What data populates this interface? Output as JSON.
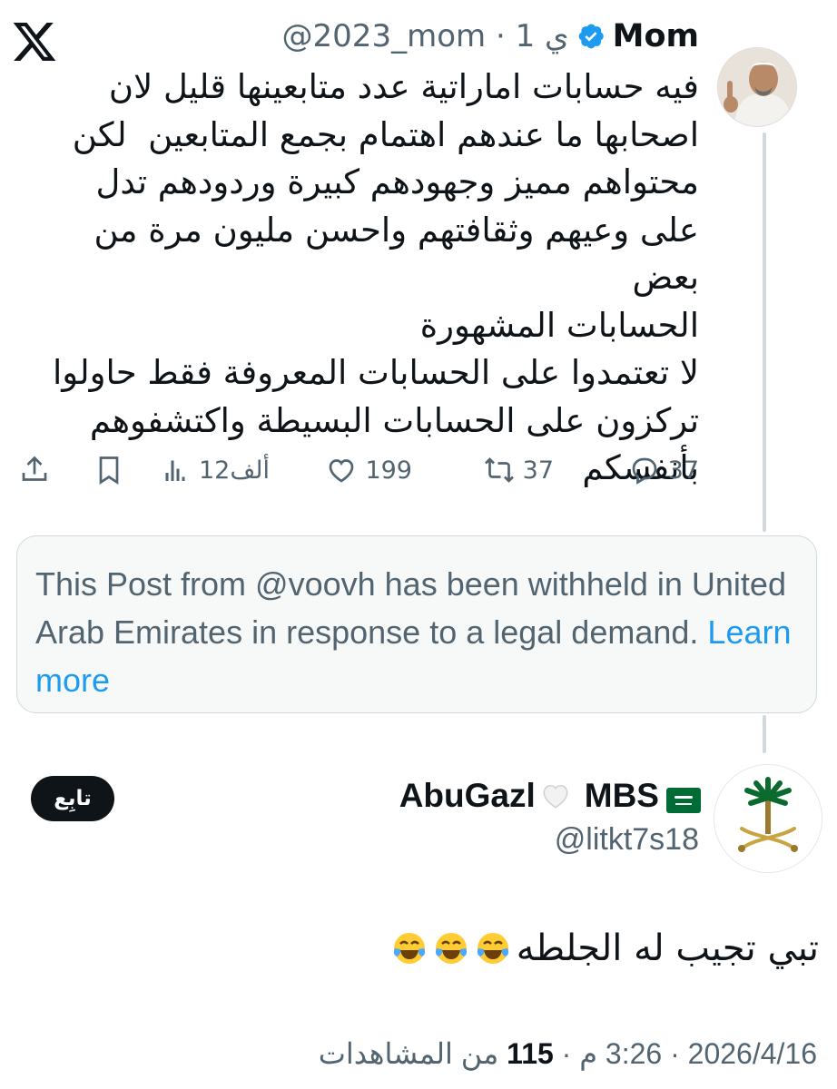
{
  "header": {
    "x_logo": "x-logo-icon",
    "author_name": "Mom",
    "author_handle": "@2023_mom",
    "time_text": "1 ي",
    "separator": "·"
  },
  "tweet": {
    "text": "فيه حسابات اماراتية عدد متابعينها قليل لان\nاصحابها ما عندهم اهتمام بجمع المتابعين  لكن\nمحتواهم مميز وجهودهم كبيرة وردودهم تدل\nعلى وعيهم وثقافتهم واحسن مليون مرة من بعض\nالحسابات المشهورة\nلا تعتمدوا على الحسابات المعروفة فقط حاولوا\nتركزون على الحسابات البسيطة واكتشفوهم\nبأنفسكم"
  },
  "actions": {
    "replies": "37",
    "reposts": "37",
    "likes": "199",
    "views": "12ألف",
    "icons": [
      "reply-icon",
      "repost-icon",
      "like-icon",
      "views-icon",
      "bookmark-icon",
      "share-icon"
    ]
  },
  "withheld": {
    "message": "This Post from @voovh has been withheld in United Arab Emirates in response to a legal demand.",
    "link": "Learn more"
  },
  "reply_author": {
    "name_a": "AbuGazl",
    "name_b": "MBS",
    "handle": "@litkt7s18",
    "follow_label": "تابِع"
  },
  "reply": {
    "text": "تبي تجيب له الجلطه",
    "emoji_count": 3
  },
  "footer": {
    "date": "2026/4/16",
    "time": "3:26 م",
    "views_count": "115",
    "views_label": "من المشاهدات",
    "separator": "·"
  },
  "colors": {
    "text": "#0f1419",
    "secondary": "#536471",
    "link": "#1d9bf0",
    "border": "#cfd9de",
    "panel_bg": "#f7f9f9"
  }
}
